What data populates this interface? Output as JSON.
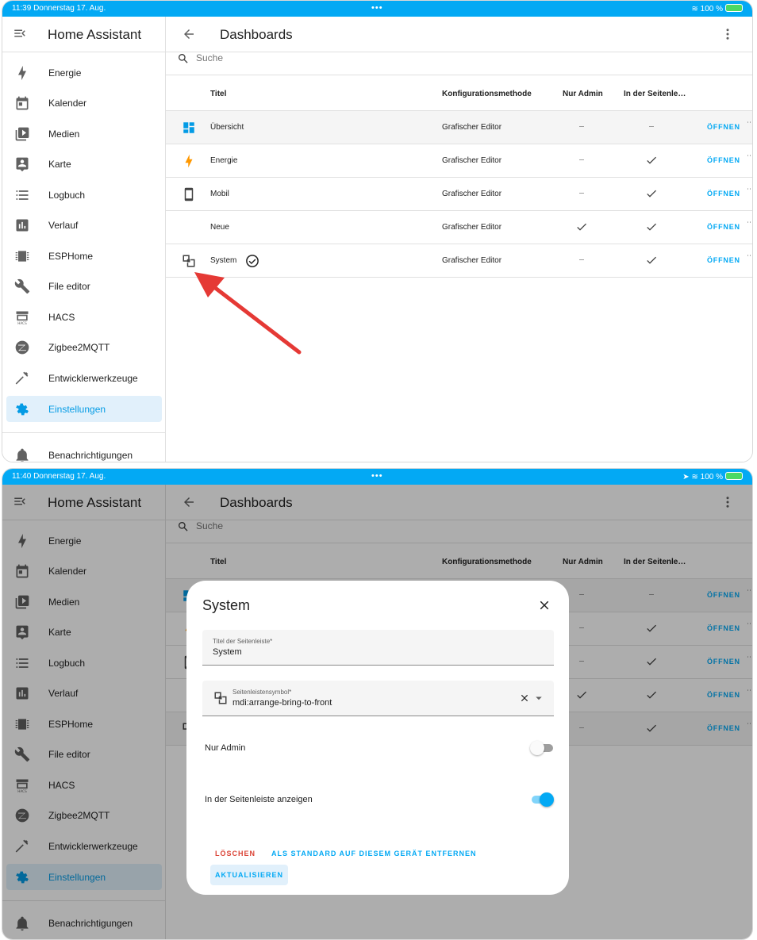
{
  "screens": [
    {
      "status": {
        "time": "11:39",
        "date": "Donnerstag 17. Aug.",
        "battery": "100 %"
      },
      "sidebar": {
        "title": "Home Assistant",
        "items": [
          {
            "label": "Energie",
            "icon": "lightning-bolt-icon"
          },
          {
            "label": "Kalender",
            "icon": "calendar-icon"
          },
          {
            "label": "Medien",
            "icon": "play-box-multiple-icon"
          },
          {
            "label": "Karte",
            "icon": "map-account-icon"
          },
          {
            "label": "Logbuch",
            "icon": "format-list-bulleted-icon"
          },
          {
            "label": "Verlauf",
            "icon": "chart-box-icon"
          },
          {
            "label": "ESPHome",
            "icon": "chip-icon"
          },
          {
            "label": "File editor",
            "icon": "wrench-icon"
          },
          {
            "label": "HACS",
            "icon": "hacs-icon"
          },
          {
            "label": "Zigbee2MQTT",
            "icon": "zigbee-icon"
          },
          {
            "label": "Entwicklerwerkzeuge",
            "icon": "hammer-icon"
          },
          {
            "label": "Einstellungen",
            "icon": "cog-icon",
            "active": true
          }
        ],
        "notifications": "Benachrichtigungen"
      },
      "main": {
        "title": "Dashboards",
        "search_placeholder": "Suche",
        "columns": [
          "Titel",
          "Konfigurationsmethode",
          "Nur Admin",
          "In der Seitenle…"
        ],
        "rows": [
          {
            "title": "Übersicht",
            "method": "Grafischer Editor",
            "admin": false,
            "sidebar": false,
            "action": "ÖFFNEN"
          },
          {
            "title": "Energie",
            "method": "Grafischer Editor",
            "admin": false,
            "sidebar": true,
            "action": "ÖFFNEN"
          },
          {
            "title": "Mobil",
            "method": "Grafischer Editor",
            "admin": false,
            "sidebar": true,
            "action": "ÖFFNEN"
          },
          {
            "title": "Neue",
            "method": "Grafischer Editor",
            "admin": true,
            "sidebar": true,
            "action": "ÖFFNEN"
          },
          {
            "title": "System",
            "method": "Grafischer Editor",
            "admin": false,
            "sidebar": true,
            "action": "ÖFFNEN",
            "default": true
          }
        ]
      }
    },
    {
      "status": {
        "time": "11:40",
        "date": "Donnerstag 17. Aug.",
        "battery": "100 %"
      },
      "dialog": {
        "title": "System",
        "sidebar_title_label": "Titel der Seitenleiste*",
        "sidebar_title_value": "System",
        "icon_label": "Seitenleistensymbol*",
        "icon_value": "mdi:arrange-bring-to-front",
        "admin_only_label": "Nur Admin",
        "admin_only": false,
        "show_in_sidebar_label": "In der Seitenleiste anzeigen",
        "show_in_sidebar": true,
        "delete_label": "LÖSCHEN",
        "remove_default_label": "ALS STANDARD AUF DIESEM GERÄT ENTFERNEN",
        "update_label": "AKTUALISIEREN"
      }
    }
  ],
  "colors": {
    "accent": "#03a9f4",
    "delete": "#db4437",
    "arrow": "#e53935",
    "energy": "#ff9800",
    "active_bg": "#e1f0fb"
  }
}
